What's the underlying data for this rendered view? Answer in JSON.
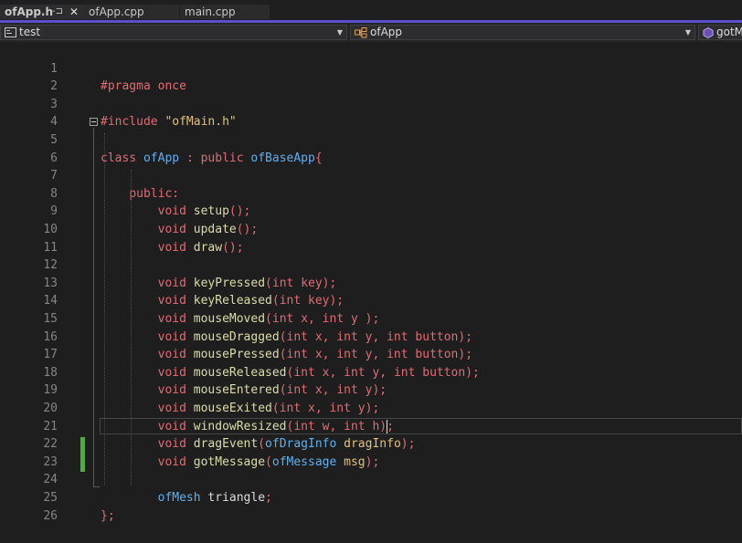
{
  "tabs": [
    {
      "label": "ofApp.h",
      "active": true,
      "pinned_glyph": "-⊐",
      "close_glyph": "✕"
    },
    {
      "label": "ofApp.cpp",
      "active": false
    },
    {
      "label": "main.cpp",
      "active": false
    }
  ],
  "accent_color": "#5a4fcf",
  "navbar": {
    "project": "test",
    "scope": "ofApp",
    "member": "gotM",
    "project_icon": "project-icon",
    "scope_icon": "class-icon",
    "member_icon": "method-icon"
  },
  "editor": {
    "line_numbers": [
      "1",
      "2",
      "3",
      "4",
      "5",
      "6",
      "7",
      "8",
      "9",
      "10",
      "11",
      "12",
      "13",
      "14",
      "15",
      "16",
      "17",
      "18",
      "19",
      "20",
      "21",
      "22",
      "23",
      "24",
      "25",
      "26"
    ],
    "code": {
      "l1_pragma": "#pragma once",
      "l3_include": "#include ",
      "l3_file": "\"ofMain.h\"",
      "l5_class": "class",
      "l5_name": "ofApp",
      "l5_colon": ":",
      "l5_public": "public",
      "l5_base": "ofBaseApp",
      "l5_brace": "{",
      "l7_public": "public",
      "l7_colon": ":",
      "void": "void",
      "setup": "setup",
      "update": "update",
      "draw": "draw",
      "keyPressed": "keyPressed",
      "keyReleased": "keyReleased",
      "mouseMoved": "mouseMoved",
      "mouseDragged": "mouseDragged",
      "mousePressed": "mousePressed",
      "mouseReleased": "mouseReleased",
      "mouseEntered": "mouseEntered",
      "mouseExited": "mouseExited",
      "windowResized": "windowResized",
      "dragEvent": "dragEvent",
      "gotMessage": "gotMessage",
      "empty_parens": "();",
      "int": "int",
      "key": "key",
      "x": "x",
      "y": "y",
      "w": "w",
      "h": "h",
      "button": "button",
      "ofDragInfo": "ofDragInfo",
      "dragInfo": "dragInfo",
      "ofMessage": "ofMessage",
      "msg": "msg",
      "ofMesh": "ofMesh",
      "triangle": "triangle",
      "semicolon": ";",
      "close_brace": "};"
    },
    "current_line": 22,
    "modified_lines": [
      23,
      24
    ]
  }
}
